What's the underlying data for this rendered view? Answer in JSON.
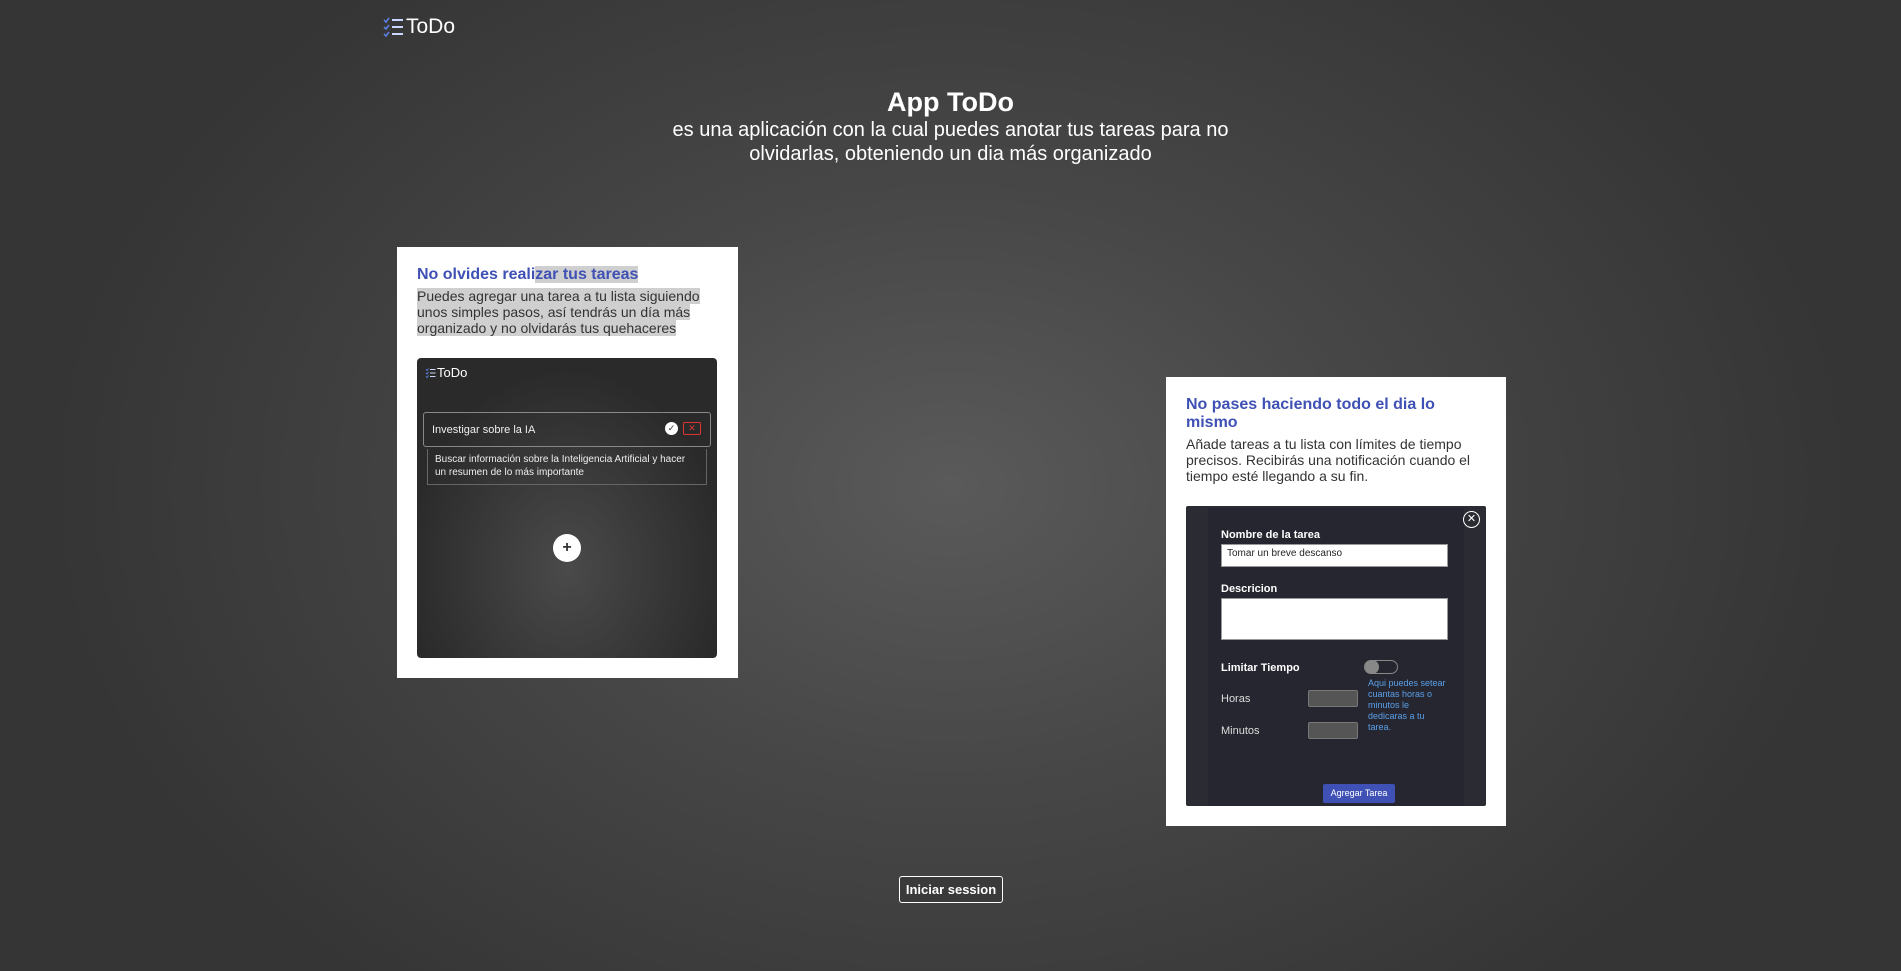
{
  "header": {
    "logo_text": "ToDo",
    "logo_icon": "checklist-icon"
  },
  "hero": {
    "title": "App ToDo",
    "subtitle": "es una aplicación con la cual puedes anotar tus tareas para no olvidarlas, obteniendo un dia más organizado"
  },
  "card1": {
    "title_part1": "No olvides reali",
    "title_part2": "zar tus tareas",
    "description": "Puedes agregar una tarea a tu lista siguiendo unos simples pasos, así tendrás un día más organizado y no olvidarás tus quehaceres",
    "preview": {
      "logo_text": "ToDo",
      "task_title": "Investigar sobre la IA",
      "task_description": "Buscar información sobre la Inteligencia Artificial y hacer un resumen de lo más importante",
      "add_symbol": "+"
    }
  },
  "card2": {
    "title": "No pases haciendo todo el dia lo mismo",
    "description": "Añade tareas a tu lista con límites de tiempo precisos. Recibirás una notificación cuando el tiempo esté llegando a su fin.",
    "preview": {
      "name_label": "Nombre de la tarea",
      "name_value": "Tomar un breve descanso",
      "desc_label": "Descricion",
      "desc_value": "",
      "limit_label": "Limitar Tiempo",
      "limit_enabled": false,
      "hours_label": "Horas",
      "minutes_label": "Minutos",
      "hint": "Aqui puedes setear cuantas horas o minutos le dedicaras a tu tarea.",
      "submit_label": "Agregar Tarea"
    }
  },
  "login_button": "Iniciar session",
  "colors": {
    "accent": "#3f51b5",
    "hint": "#5aa0e8",
    "delete": "#dd3333"
  }
}
